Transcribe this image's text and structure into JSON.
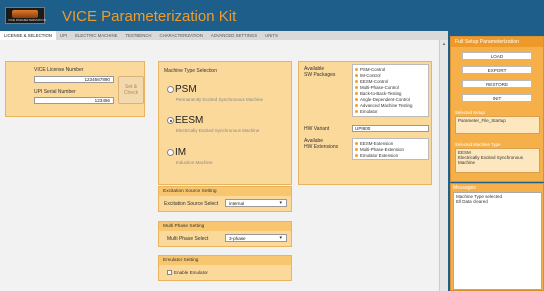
{
  "header": {
    "logo_text": "VICE PARAMETERIZATION",
    "title": "VICE Parameterization Kit"
  },
  "tabs": [
    {
      "label": "LICENSE & SELECTION"
    },
    {
      "label": "UPI"
    },
    {
      "label": "ELECTRIC MACHINE"
    },
    {
      "label": "TESTBENCH"
    },
    {
      "label": "CHARACTERIZATION"
    },
    {
      "label": "ADVANCED SETTINGS"
    },
    {
      "label": "UNITS"
    }
  ],
  "license": {
    "license_label": "VICE License Number",
    "license_value": "1234567890",
    "serial_label": "UPI Serial Number",
    "serial_value": "123456",
    "set_check_line1": "Set &",
    "set_check_line2": "Check"
  },
  "machine_type": {
    "heading": "Machine Type Selection",
    "options": [
      {
        "code": "PSM",
        "desc": "Permanently Excited Synchronous Machine",
        "selected": false
      },
      {
        "code": "EESM",
        "desc": "Electrically Excited Synchronous Machine",
        "selected": true
      },
      {
        "code": "IM",
        "desc": "Induction Machine",
        "selected": false
      }
    ]
  },
  "packages": {
    "sw_label_1": "Available",
    "sw_label_2": "SW Packages",
    "sw_items": [
      "PSM-Control",
      "IM-Control",
      "EESM-Control",
      "Multi-Phase-Control",
      "Back-to-Back-Testing",
      "Angle-Dependent-Control",
      "Advanced Machine Testing",
      "Emulator"
    ],
    "hw_variant_label": "HW Variant",
    "hw_variant_value": "UPI800",
    "hw_ext_label_1": "Availabe",
    "hw_ext_label_2": "HW Extensions",
    "hw_items": [
      "EESM-Extension",
      "Multi-Phase-Extension",
      "Emulator Extension"
    ]
  },
  "excitation": {
    "heading": "Excitation Source Setting",
    "label": "Excitation Source Select",
    "value": "internal"
  },
  "multiphase": {
    "heading": "Multi Phase Setting",
    "label": "Multi Phase Select",
    "value": "3-phase"
  },
  "emulator": {
    "heading": "Emulator Setting",
    "checkbox_label": "Enable Emulator"
  },
  "side": {
    "heading": "Full Setup Parameterization",
    "buttons": [
      "LOAD",
      "EXPORT",
      "RESTORE",
      "INIT"
    ],
    "selected_setup_label": "Selected Setup",
    "selected_setup_value": "Parameter_File_Startup",
    "selected_machine_label": "Selected Machine Type",
    "selected_machine_line1": "EESM",
    "selected_machine_line2": "Electrically Excited Synchronous Machine"
  },
  "messages": {
    "heading": "Messages",
    "lines": [
      "Machine Type selected",
      "Ell Data cleared"
    ]
  }
}
